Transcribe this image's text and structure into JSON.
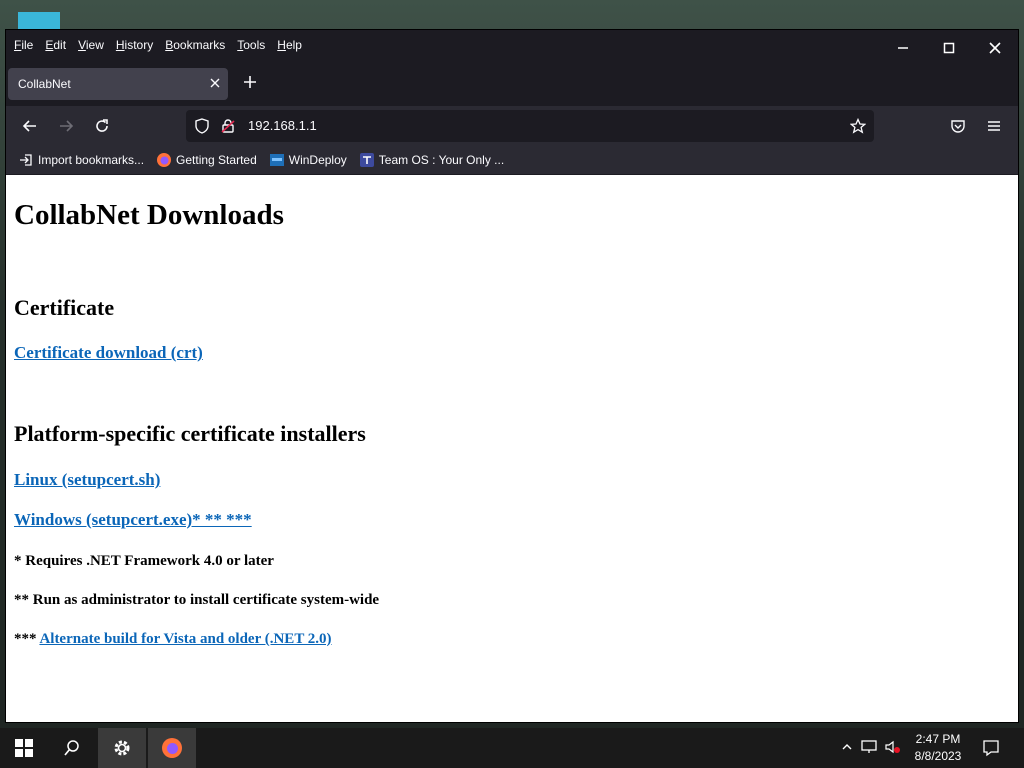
{
  "menu": [
    "File",
    "Edit",
    "View",
    "History",
    "Bookmarks",
    "Tools",
    "Help"
  ],
  "tab": {
    "title": "CollabNet"
  },
  "address": {
    "url": "192.168.1.1"
  },
  "bookmarks": [
    {
      "label": "Import bookmarks...",
      "icon": "import-icon"
    },
    {
      "label": "Getting Started",
      "icon": "firefox-icon"
    },
    {
      "label": "WinDeploy",
      "icon": "windeploy-icon"
    },
    {
      "label": "Team OS : Your Only ...",
      "icon": "teamos-icon"
    }
  ],
  "page": {
    "title": "CollabNet Downloads",
    "section1_heading": "Certificate",
    "cert_link": "Certificate download (crt)",
    "section2_heading": "Platform-specific certificate installers",
    "linux_link": "Linux (setupcert.sh)",
    "windows_link": "Windows (setupcert.exe)* ** ***",
    "note1": "* Requires .NET Framework 4.0 or later",
    "note2": "** Run as administrator to install certificate system-wide",
    "note3_prefix": "*** ",
    "note3_link": "Alternate build for Vista and older (.NET 2.0)"
  },
  "taskbar": {
    "time": "2:47 PM",
    "date": "8/8/2023"
  },
  "colors": {
    "link": "#0b66b8",
    "chrome_dark": "#1c1b22",
    "toolbar": "#2b2a33",
    "tab_active": "#42414d"
  }
}
